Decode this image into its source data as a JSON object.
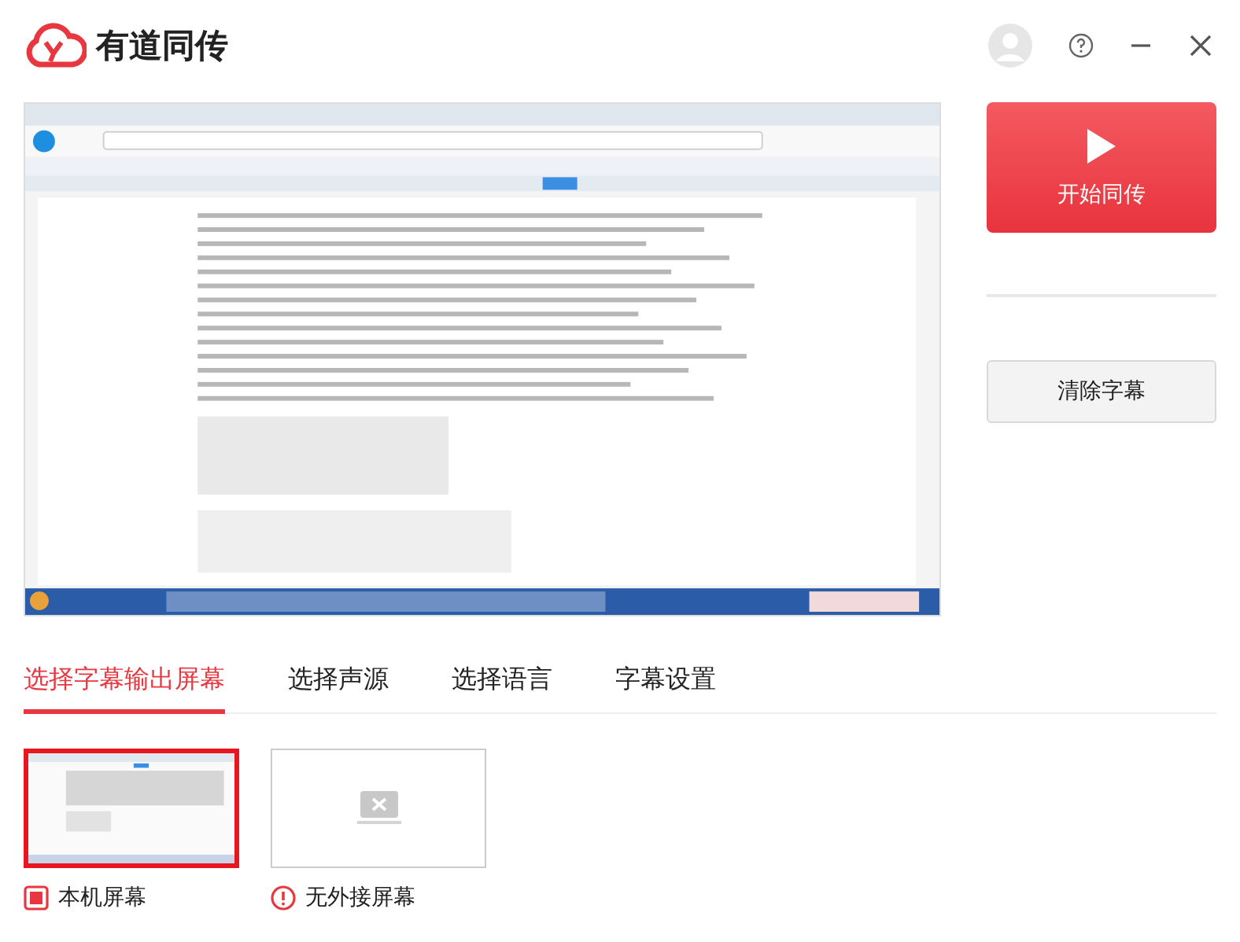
{
  "app": {
    "title": "有道同传"
  },
  "actions": {
    "start": "开始同传",
    "clear": "清除字幕"
  },
  "tabs": [
    {
      "label": "选择字幕输出屏幕",
      "selected": true
    },
    {
      "label": "选择声源",
      "selected": false
    },
    {
      "label": "选择语言",
      "selected": false
    },
    {
      "label": "字幕设置",
      "selected": false
    }
  ],
  "screens": [
    {
      "label": "本机屏幕",
      "kind": "local",
      "selected": true
    },
    {
      "label": "无外接屏幕",
      "kind": "none",
      "selected": false
    }
  ]
}
